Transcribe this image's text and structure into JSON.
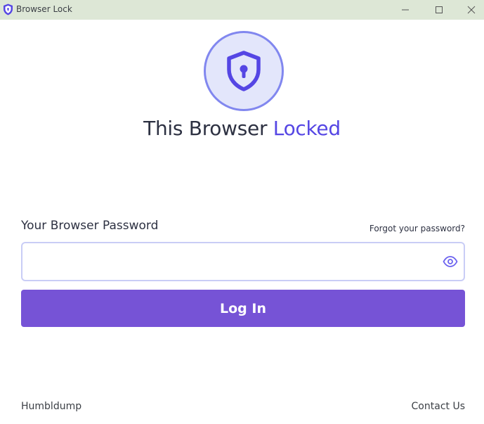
{
  "window": {
    "title": "Browser Lock"
  },
  "hero": {
    "title_part1": "This Browser ",
    "title_part2": "Locked"
  },
  "form": {
    "password_label": "Your Browser Password",
    "forgot_link": "Forgot your password?",
    "password_value": "",
    "login_button": "Log In"
  },
  "footer": {
    "brand": "Humbldump",
    "contact_link": "Contact Us"
  },
  "icons": {
    "app": "shield-lock-icon",
    "hero": "shield-keyhole-icon",
    "toggle_visibility": "eye-icon",
    "minimize": "minimize-icon",
    "maximize": "maximize-icon",
    "close": "close-icon"
  },
  "colors": {
    "titlebar": "#dde7d6",
    "accent": "#5546e4",
    "button": "#7653d6",
    "circle_fill": "#e3e6fb",
    "circle_border": "#8187ef",
    "field_border": "#c9cdf6"
  }
}
